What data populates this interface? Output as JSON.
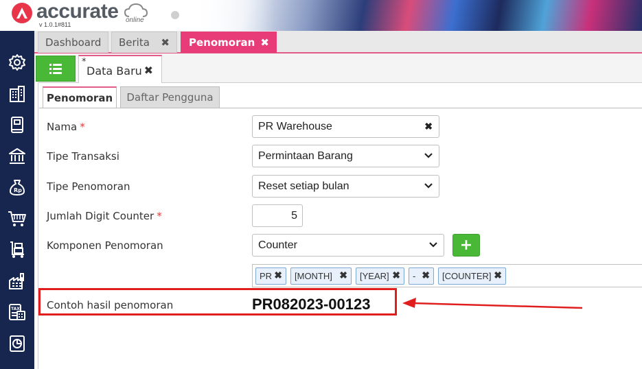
{
  "app": {
    "logo_text": "accurate",
    "logo_sub": "online",
    "version": "v 1.0.1#811"
  },
  "sidebar": {
    "items": [
      {
        "icon": "gear-icon"
      },
      {
        "icon": "building-icon"
      },
      {
        "icon": "book-icon"
      },
      {
        "icon": "bank-icon"
      },
      {
        "icon": "money-bag-icon"
      },
      {
        "icon": "cart-icon"
      },
      {
        "icon": "hand-truck-icon"
      },
      {
        "icon": "factory-icon"
      },
      {
        "icon": "tax-calculator-icon"
      },
      {
        "icon": "report-chart-icon"
      }
    ]
  },
  "tabs": [
    {
      "label": "Dashboard"
    },
    {
      "label": "Berita",
      "close": "✖"
    },
    {
      "label": "Penomoran",
      "close": "✖"
    }
  ],
  "subtab": {
    "modified_marker": "*",
    "label": "Data Baru",
    "close": "✖"
  },
  "inner_tabs": [
    {
      "label": "Penomoran"
    },
    {
      "label": "Daftar Pengguna"
    }
  ],
  "form": {
    "nama": {
      "label": "Nama",
      "required": "*",
      "value": "PR Warehouse",
      "clear": "✖"
    },
    "tipe_transaksi": {
      "label": "Tipe Transaksi",
      "value": "Permintaan Barang"
    },
    "tipe_penomoran": {
      "label": "Tipe Penomoran",
      "value": "Reset setiap bulan"
    },
    "jumlah_digit": {
      "label": "Jumlah Digit Counter",
      "required": "*",
      "value": "5"
    },
    "komponen": {
      "label": "Komponen Penomoran",
      "value": "Counter",
      "add": "+"
    },
    "chips": [
      {
        "label": "PR",
        "x": "✖"
      },
      {
        "label": "[MONTH]",
        "x": "✖"
      },
      {
        "label": "[YEAR]",
        "x": "✖"
      },
      {
        "label": "-",
        "x": "✖"
      },
      {
        "label": "[COUNTER]",
        "x": "✖"
      }
    ],
    "example": {
      "label": "Contoh hasil penomoran",
      "value": "PR082023-00123"
    }
  },
  "colors": {
    "sidebar": "#17264f",
    "accent": "#e83c78",
    "green": "#4ab837",
    "highlight": "#e01e1e"
  }
}
